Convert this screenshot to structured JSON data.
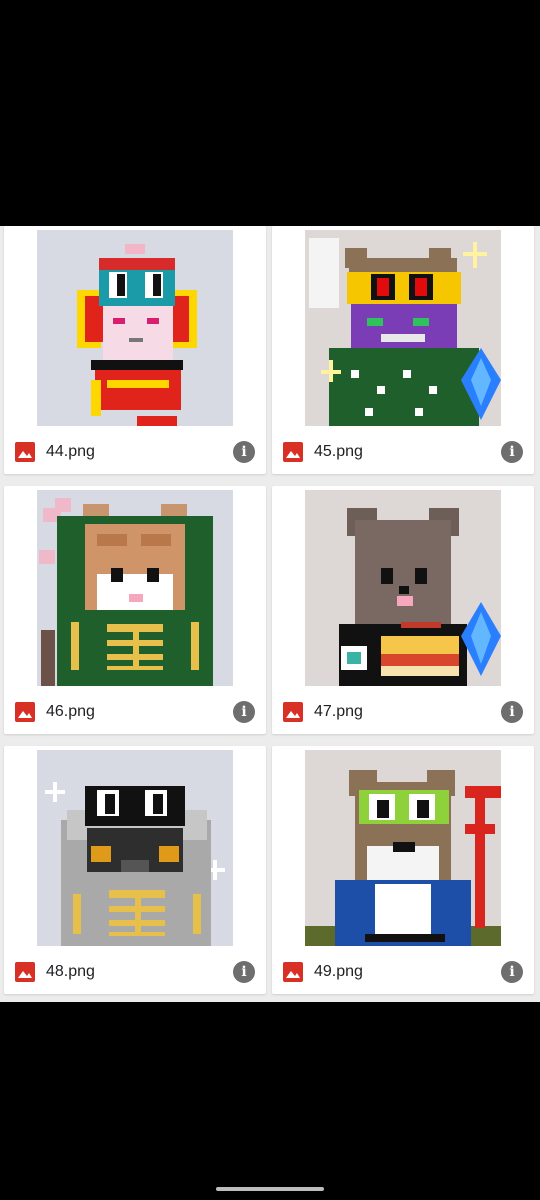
{
  "files": [
    {
      "name": "44.png",
      "subject": "red-lion-dancer",
      "bg": "#d7d9e3"
    },
    {
      "name": "45.png",
      "subject": "green-frog-bear",
      "bg": "#ddd8d6"
    },
    {
      "name": "46.png",
      "subject": "green-daruma-cat",
      "bg": "#d7d9e3"
    },
    {
      "name": "47.png",
      "subject": "brown-bear",
      "bg": "#ddd8d6"
    },
    {
      "name": "48.png",
      "subject": "grey-daruma-cat",
      "bg": "#d7d9e3"
    },
    {
      "name": "49.png",
      "subject": "blue-coat-bear",
      "bg": "#ddd8d6"
    }
  ],
  "icons": {
    "file_type": "image-icon",
    "info": "info-icon"
  },
  "info_glyph": "i",
  "colors": {
    "image_icon": "#d93025",
    "info_button": "#6e6e6e",
    "grid_background": "#ececec"
  }
}
